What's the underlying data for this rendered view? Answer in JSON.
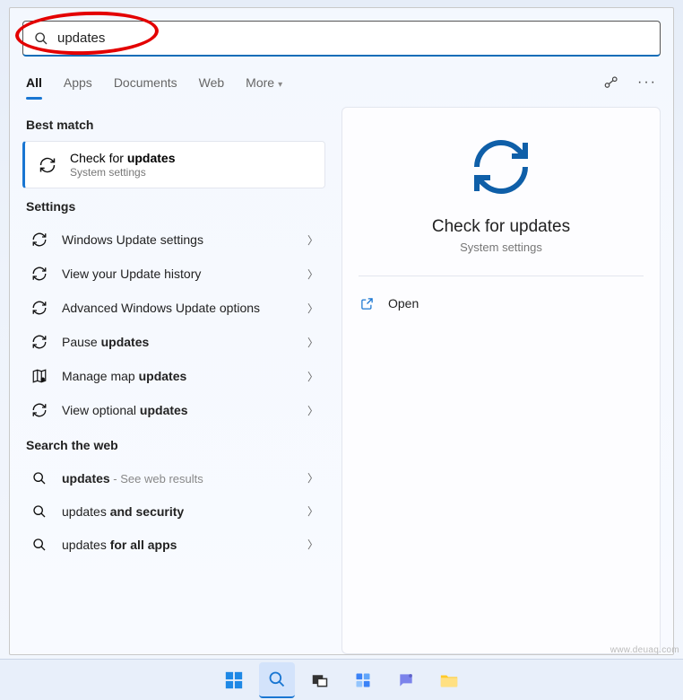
{
  "search": {
    "value": "updates"
  },
  "tabs": {
    "all": "All",
    "apps": "Apps",
    "documents": "Documents",
    "web": "Web",
    "more": "More"
  },
  "best_match": {
    "heading": "Best match",
    "title_html": "Check for <b>updates</b>",
    "subtitle": "System settings"
  },
  "settings": {
    "heading": "Settings",
    "items": [
      {
        "icon": "sync",
        "label_html": "Windows Update settings"
      },
      {
        "icon": "sync",
        "label_html": "View your Update history"
      },
      {
        "icon": "sync",
        "label_html": "Advanced Windows Update options"
      },
      {
        "icon": "sync",
        "label_html": "Pause <b>updates</b>"
      },
      {
        "icon": "map",
        "label_html": "Manage map <b>updates</b>"
      },
      {
        "icon": "sync",
        "label_html": "View optional <b>updates</b>"
      }
    ]
  },
  "web": {
    "heading": "Search the web",
    "items": [
      {
        "label_html": "<b>updates</b>",
        "suffix": " - See web results"
      },
      {
        "label_html": "updates <b>and security</b>",
        "suffix": ""
      },
      {
        "label_html": "updates <b>for all apps</b>",
        "suffix": ""
      }
    ]
  },
  "detail": {
    "title": "Check for updates",
    "subtitle": "System settings",
    "open": "Open"
  },
  "watermark": "www.deuaq.com"
}
